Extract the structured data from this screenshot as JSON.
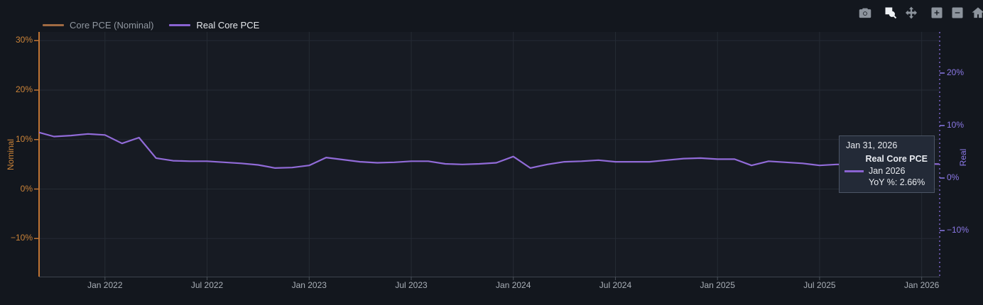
{
  "page": {
    "background": "#13171e",
    "plot_background": "#171b23",
    "gridline_color": "#252b34"
  },
  "toolbar": {
    "icons": [
      {
        "name": "camera-icon",
        "active": false
      },
      {
        "name": "box-zoom-icon",
        "active": true
      },
      {
        "name": "pan-icon",
        "active": false
      },
      {
        "name": "zoom-in-icon",
        "active": false
      },
      {
        "name": "zoom-out-icon",
        "active": false
      },
      {
        "name": "home-icon",
        "active": false
      }
    ]
  },
  "legend": {
    "items": [
      {
        "label": "Core PCE (Nominal)",
        "swatch_color": "#a06a42",
        "text_color": "#9097a0",
        "visible": false
      },
      {
        "label": "Real Core PCE",
        "swatch_color": "#8a63d2",
        "text_color": "#e6e9ed",
        "visible": true
      }
    ]
  },
  "tooltip": {
    "date": "Jan 31, 2026",
    "series": "Real Core PCE",
    "point_label": "Jan 2026",
    "value_label": "YoY %: 2.66%",
    "accent": "#8a63d2"
  },
  "chart_data": {
    "type": "line",
    "title": "",
    "legend_position": "top-left",
    "grid": true,
    "x_ticks": [
      "Jan 2022",
      "Jul 2022",
      "Jan 2023",
      "Jul 2023",
      "Jan 2024",
      "Jul 2024",
      "Jan 2025",
      "Jul 2025",
      "Jan 2026"
    ],
    "x_tick_months": [
      "2022-01",
      "2022-07",
      "2023-01",
      "2023-07",
      "2024-01",
      "2024-07",
      "2025-01",
      "2025-07",
      "2026-01"
    ],
    "x_range_months": [
      "2021-08",
      "2026-02"
    ],
    "y_left": {
      "title": "Nominal",
      "ticks": [
        "30%",
        "20%",
        "10%",
        "0%",
        "−10%"
      ],
      "values": [
        30,
        20,
        10,
        0,
        -10
      ],
      "range": [
        -17.5,
        31.8
      ],
      "color": "#cd8438"
    },
    "y_right": {
      "title": "Real",
      "ticks": [
        "20%",
        "10%",
        "0%",
        "−10%"
      ],
      "values": [
        20,
        10,
        0,
        -10
      ],
      "range": [
        -18.8,
        27.8
      ],
      "color": "#8b78e6"
    },
    "series": [
      {
        "name": "Core PCE (Nominal)",
        "axis": "left",
        "color": "#b5763f",
        "visible": false,
        "x": [],
        "values": []
      },
      {
        "name": "Real Core PCE",
        "axis": "right",
        "color": "#916bd8",
        "visible": true,
        "unit": "YoY %",
        "x": [
          "2021-08",
          "2021-09",
          "2021-10",
          "2021-11",
          "2021-12",
          "2022-01",
          "2022-02",
          "2022-03",
          "2022-04",
          "2022-05",
          "2022-06",
          "2022-07",
          "2022-08",
          "2022-09",
          "2022-10",
          "2022-11",
          "2022-12",
          "2023-01",
          "2023-02",
          "2023-03",
          "2023-04",
          "2023-05",
          "2023-06",
          "2023-07",
          "2023-08",
          "2023-09",
          "2023-10",
          "2023-11",
          "2023-12",
          "2024-01",
          "2024-02",
          "2024-03",
          "2024-04",
          "2024-05",
          "2024-06",
          "2024-07",
          "2024-08",
          "2024-09",
          "2024-10",
          "2024-11",
          "2024-12",
          "2025-01",
          "2025-02",
          "2025-03",
          "2025-04",
          "2025-05",
          "2025-06",
          "2025-07",
          "2025-08",
          "2025-09",
          "2025-10",
          "2025-11",
          "2025-12",
          "2026-01"
        ],
        "values": [
          8.8,
          7.9,
          8.1,
          8.4,
          8.2,
          6.6,
          7.7,
          3.8,
          3.3,
          3.2,
          3.2,
          3.0,
          2.8,
          2.5,
          1.9,
          2.0,
          2.4,
          3.9,
          3.5,
          3.1,
          2.9,
          3.0,
          3.2,
          3.2,
          2.7,
          2.6,
          2.7,
          2.9,
          4.1,
          1.9,
          2.6,
          3.1,
          3.2,
          3.4,
          3.1,
          3.1,
          3.1,
          3.4,
          3.7,
          3.8,
          3.6,
          3.6,
          2.4,
          3.2,
          3.0,
          2.8,
          2.4,
          2.6,
          2.6,
          2.7,
          2.7,
          2.7,
          2.7,
          2.66
        ]
      }
    ]
  }
}
